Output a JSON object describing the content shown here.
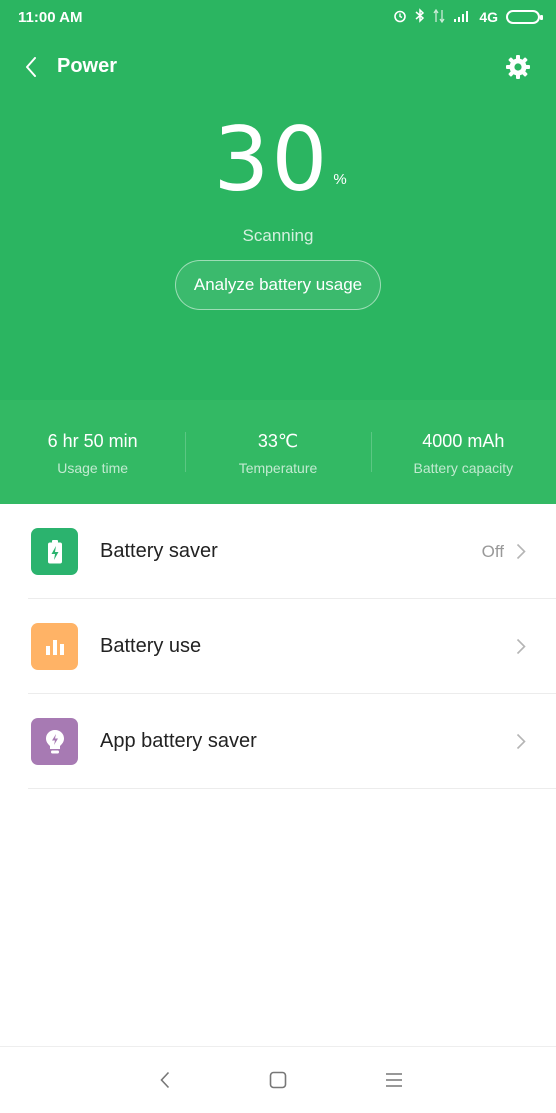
{
  "status_bar": {
    "time": "11:00 AM",
    "network": "4G",
    "icons": [
      "alarm-icon",
      "bluetooth-icon",
      "data-arrows-icon",
      "signal-icon",
      "battery-icon"
    ]
  },
  "appbar": {
    "title": "Power",
    "back_icon": "chevron-left-icon",
    "settings_icon": "gear-icon"
  },
  "battery": {
    "percent": "30",
    "percent_sign": "%",
    "status": "Scanning",
    "analyze_label": "Analyze battery usage"
  },
  "stats": [
    {
      "value": "6 hr 50 min",
      "label": "Usage time"
    },
    {
      "value": "33℃",
      "label": "Temperature"
    },
    {
      "value": "4000 mAh",
      "label": "Battery capacity"
    }
  ],
  "menu": [
    {
      "label": "Battery saver",
      "value": "Off",
      "icon": "battery-bolt-icon",
      "color": "#2bb36e"
    },
    {
      "label": "Battery use",
      "value": "",
      "icon": "bar-chart-icon",
      "color": "#ffb366"
    },
    {
      "label": "App battery saver",
      "value": "",
      "icon": "bulb-bolt-icon",
      "color": "#a77ab3"
    }
  ],
  "navbar": {
    "icons": [
      "nav-back-icon",
      "nav-home-icon",
      "nav-menu-icon"
    ]
  },
  "colors": {
    "header_green": "#2bb561",
    "stats_green": "#33b964"
  }
}
